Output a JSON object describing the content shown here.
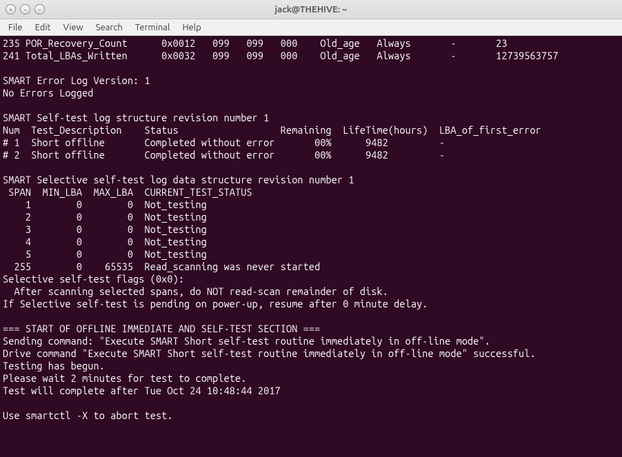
{
  "window": {
    "title": "jack@THEHIVE: ~"
  },
  "menubar": {
    "items": [
      "File",
      "Edit",
      "View",
      "Search",
      "Terminal",
      "Help"
    ]
  },
  "terminal": {
    "content": "235 POR_Recovery_Count      0x0012   099   099   000    Old_age   Always       -       23\n241 Total_LBAs_Written      0x0032   099   099   000    Old_age   Always       -       12739563757\n\nSMART Error Log Version: 1\nNo Errors Logged\n\nSMART Self-test log structure revision number 1\nNum  Test_Description    Status                  Remaining  LifeTime(hours)  LBA_of_first_error\n# 1  Short offline       Completed without error       00%      9482         -\n# 2  Short offline       Completed without error       00%      9482         -\n\nSMART Selective self-test log data structure revision number 1\n SPAN  MIN_LBA  MAX_LBA  CURRENT_TEST_STATUS\n    1        0        0  Not_testing\n    2        0        0  Not_testing\n    3        0        0  Not_testing\n    4        0        0  Not_testing\n    5        0        0  Not_testing\n  255        0    65535  Read_scanning was never started\nSelective self-test flags (0x0):\n  After scanning selected spans, do NOT read-scan remainder of disk.\nIf Selective self-test is pending on power-up, resume after 0 minute delay.\n\n=== START OF OFFLINE IMMEDIATE AND SELF-TEST SECTION ===\nSending command: \"Execute SMART Short self-test routine immediately in off-line mode\".\nDrive command \"Execute SMART Short self-test routine immediately in off-line mode\" successful.\nTesting has begun.\nPlease wait 2 minutes for test to complete.\nTest will complete after Tue Oct 24 10:48:44 2017\n\nUse smartctl -X to abort test."
  }
}
